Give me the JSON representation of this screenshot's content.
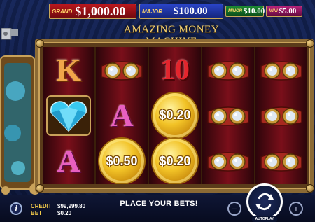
{
  "game": {
    "title": "AMAZING MONEY MACHINE"
  },
  "jackpots": {
    "grand": {
      "label": "GRAND",
      "value": "$1,000.00"
    },
    "major": {
      "label": "MAJOR",
      "value": "$100.00"
    },
    "minor": {
      "label": "MINOR",
      "value": "$10.00"
    },
    "mini": {
      "label": "MINI",
      "value": "$5.00"
    }
  },
  "reels": [
    [
      {
        "type": "letter",
        "text": "K"
      },
      {
        "type": "diamond",
        "icon": "blue-heart-diamond-icon"
      },
      {
        "type": "letter",
        "text": "A"
      }
    ],
    [
      {
        "type": "goggles",
        "icon": "goggles-icon"
      },
      {
        "type": "letter",
        "text": "A"
      },
      {
        "type": "coin",
        "text": "$0.50"
      }
    ],
    [
      {
        "type": "letter",
        "text": "10"
      },
      {
        "type": "coin",
        "text": "$0.20"
      },
      {
        "type": "coin",
        "text": "$0.20"
      }
    ],
    [
      {
        "type": "goggles",
        "icon": "goggles-icon"
      },
      {
        "type": "goggles",
        "icon": "goggles-icon"
      },
      {
        "type": "goggles",
        "icon": "goggles-icon"
      }
    ],
    [
      {
        "type": "goggles",
        "icon": "goggles-icon"
      },
      {
        "type": "goggles",
        "icon": "goggles-icon"
      },
      {
        "type": "goggles",
        "icon": "goggles-icon"
      }
    ]
  ],
  "footer": {
    "credit_label": "CREDIT",
    "credit_value": "$99,999.80",
    "bet_label": "BET",
    "bet_value": "$0.20",
    "message": "PLACE YOUR BETS!",
    "autoplay_label": "AUTOPLAY",
    "minus_icon": "minus-icon",
    "plus_icon": "plus-icon",
    "spin_icon": "spin-arrows-icon",
    "info_icon": "info-icon",
    "menu_icon": "menu-icon"
  },
  "colors": {
    "gold": "#f0c94a",
    "grand": "#b9171d",
    "major": "#2a44c8",
    "minor": "#1c8a33",
    "mini": "#b6237a"
  }
}
